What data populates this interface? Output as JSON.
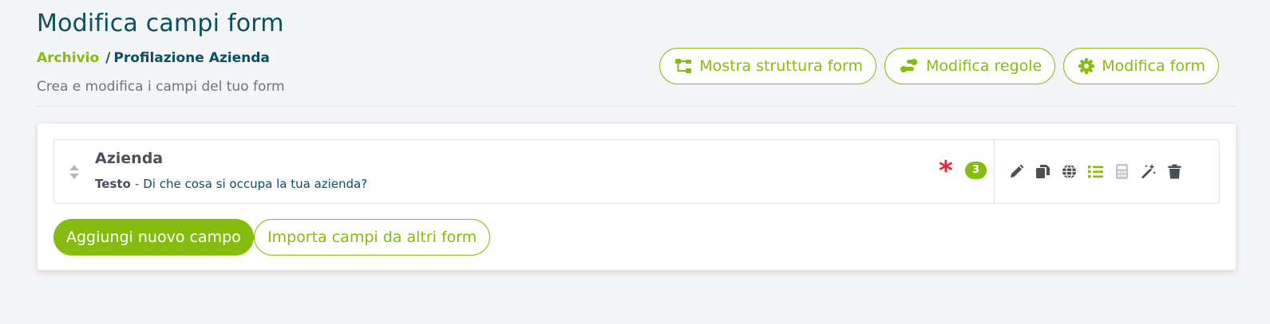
{
  "page": {
    "title": "Modifica campi form",
    "subtitle": "Crea e modifica i campi del tuo form"
  },
  "breadcrumb": {
    "items": [
      {
        "label": "Archivio"
      },
      {
        "label": "Profilazione Azienda"
      }
    ],
    "separator": "/"
  },
  "header_actions": [
    {
      "label": "Mostra struttura form",
      "icon": "sitemap-icon"
    },
    {
      "label": "Modifica regole",
      "icon": "route-icon"
    },
    {
      "label": "Modifica form",
      "icon": "gear-icon"
    }
  ],
  "field": {
    "name": "Azienda",
    "type": "Testo",
    "separator": "-",
    "question": "Di che cosa si occupa la tua azienda?",
    "required_marker": "*",
    "badge_count": "3",
    "actions": [
      "pencil-icon",
      "copy-icon",
      "globe-icon",
      "list-icon",
      "calculator-icon",
      "magic-wand-icon",
      "trash-icon"
    ]
  },
  "footer_actions": {
    "add_field": "Aggiungi nuovo campo",
    "import_fields": "Importa campi da altri form"
  },
  "colors": {
    "accent": "#86bc0f",
    "title": "#0a4f63",
    "required": "#e0263a",
    "icon": "#4a4f55",
    "disabled_icon": "#c3c8cc"
  }
}
